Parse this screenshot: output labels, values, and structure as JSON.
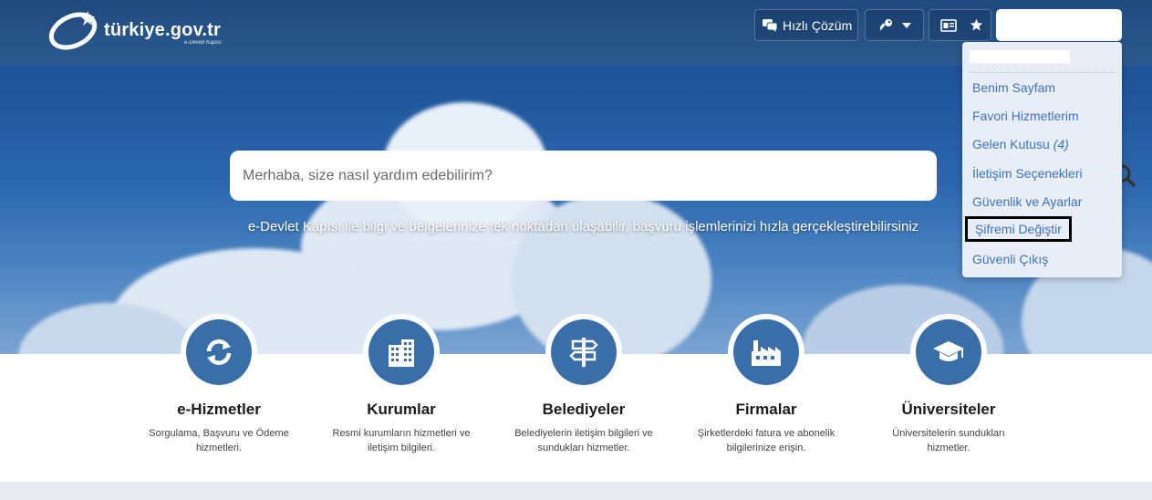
{
  "header": {
    "brand": "türkiye.gov.tr",
    "tagline": "e-Devlet Kapısı",
    "quick_solution_label": "Hızlı Çözüm",
    "icons": [
      "chat-icon",
      "key-icon",
      "id-card-icon",
      "star-icon"
    ]
  },
  "search": {
    "placeholder": "Merhaba, size nasıl yardım edebilirim?"
  },
  "hero": {
    "tagline": "e-Devlet Kapısı ile bilgi ve belgelerinize tek noktadan ulaşabilir, başvuru işlemlerinizi hızla gerçekleştirebilirsiniz"
  },
  "user_menu": {
    "items": [
      {
        "label": "Benim Sayfam"
      },
      {
        "label": "Favori Hizmetlerim"
      },
      {
        "label": "Gelen Kutusu",
        "count": "(4)"
      },
      {
        "label": "İletişim Seçenekleri"
      },
      {
        "label": "Güvenlik ve Ayarlar"
      },
      {
        "label": "Şifremi Değiştir",
        "highlighted": true
      },
      {
        "label": "Güvenli Çıkış"
      }
    ]
  },
  "categories": [
    {
      "title": "e-Hizmetler",
      "desc": "Sorgulama, Başvuru ve Ödeme hizmetleri.",
      "icon": "refresh-icon"
    },
    {
      "title": "Kurumlar",
      "desc": "Resmi kurumların hizmetleri ve iletişim bilgileri.",
      "icon": "building-icon"
    },
    {
      "title": "Belediyeler",
      "desc": "Belediyelerin iletişim bilgileri ve sundukları hizmetler.",
      "icon": "signpost-icon"
    },
    {
      "title": "Firmalar",
      "desc": "Şirketlerdeki fatura ve abonelik bilgilerinize erişin.",
      "icon": "factory-icon"
    },
    {
      "title": "Üniversiteler",
      "desc": "Üniversitelerin sundukları hizmetler.",
      "icon": "graduation-cap-icon"
    }
  ],
  "colors": {
    "header_bg": "#24507f",
    "accent_blue": "#3a6ea8",
    "link_blue": "#3b73b9",
    "highlight_border": "#000000"
  }
}
